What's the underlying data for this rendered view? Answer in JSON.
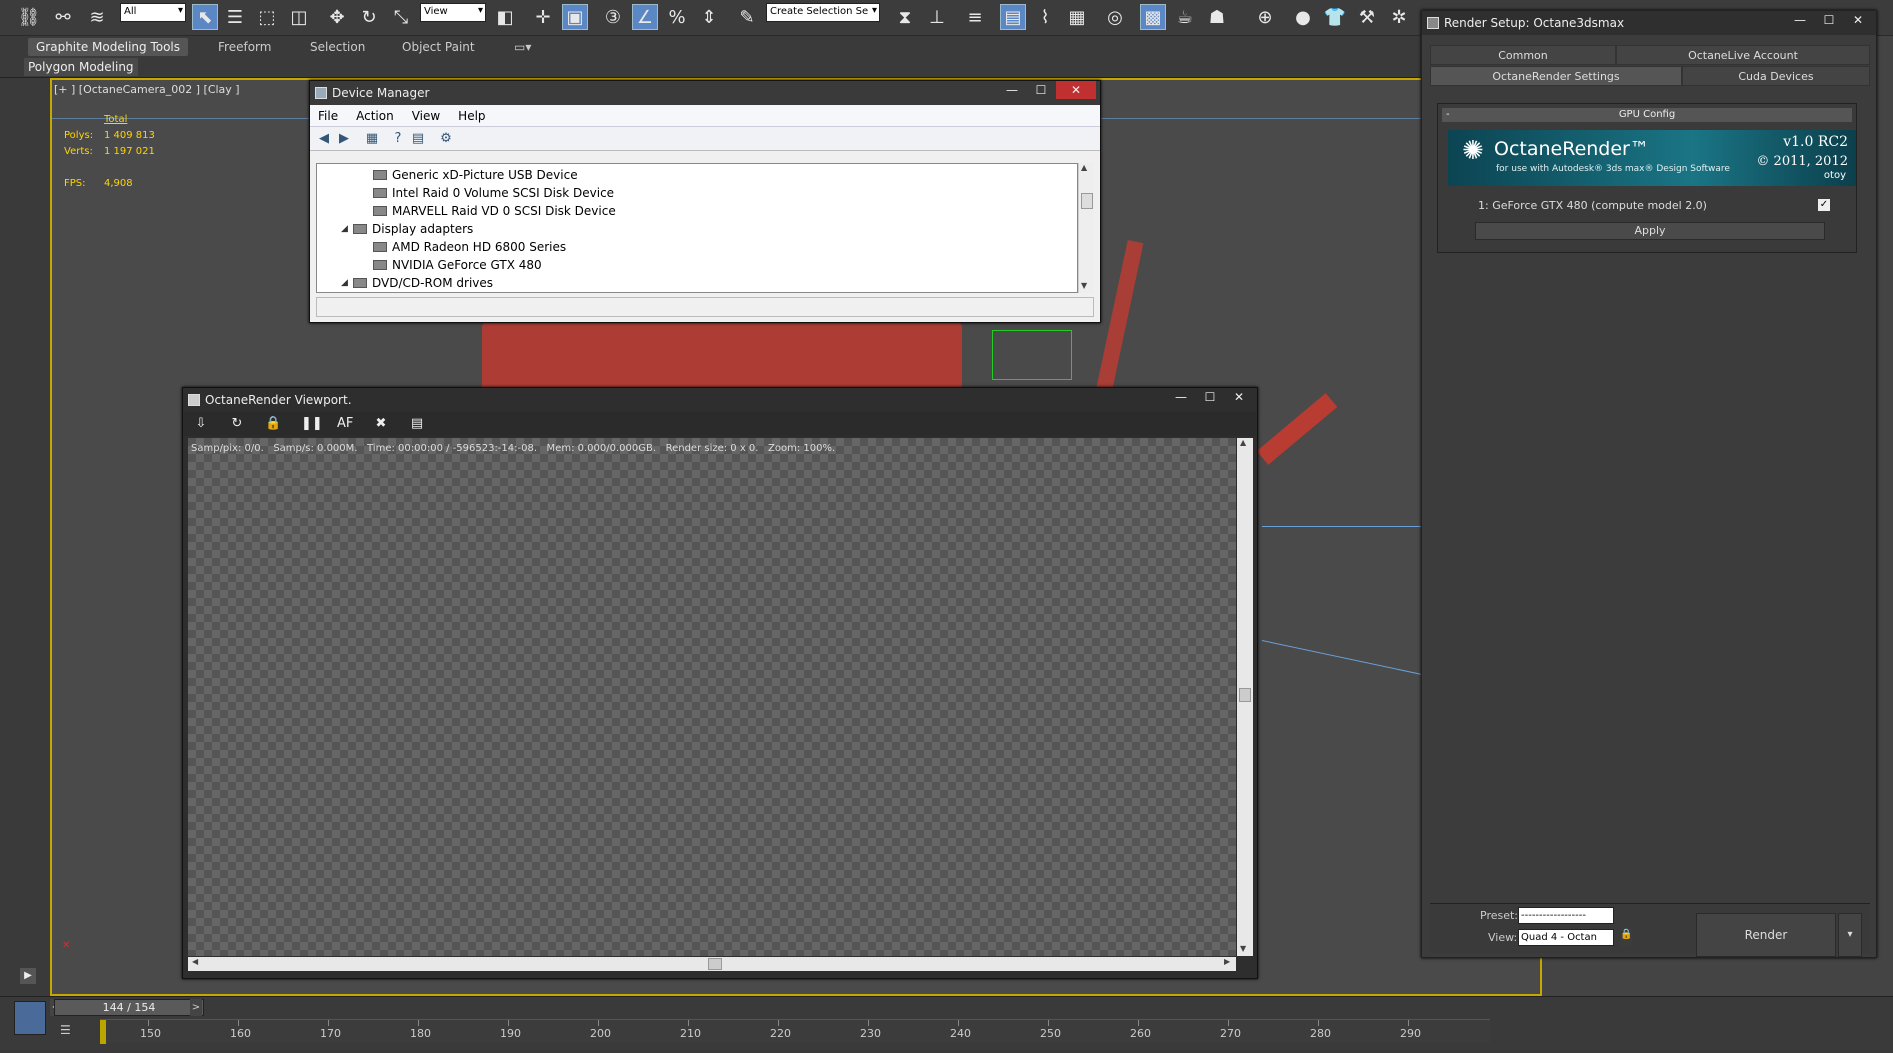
{
  "toolbar": {
    "selection_filter": "All",
    "ref_coord": "View",
    "named_selection": "Create Selection Se"
  },
  "ribbon": {
    "tabs": [
      "Graphite Modeling Tools",
      "Freeform",
      "Selection",
      "Object Paint"
    ],
    "panel": "Polygon Modeling"
  },
  "viewport": {
    "label": "[+ ] [OctaneCamera_002 ] [Clay ]",
    "stats_header": "Total",
    "polys_label": "Polys:",
    "polys_value": "1 409 813",
    "verts_label": "Verts:",
    "verts_value": "1 197 021",
    "fps_label": "FPS:",
    "fps_value": "4,908"
  },
  "timeline": {
    "frame": "144 / 154",
    "ticks": [
      "150",
      "160",
      "170",
      "180",
      "190",
      "200",
      "210",
      "220",
      "230",
      "240",
      "250",
      "260",
      "270",
      "280",
      "290"
    ]
  },
  "device_manager": {
    "title": "Device Manager",
    "menu": [
      "File",
      "Action",
      "View",
      "Help"
    ],
    "items": [
      {
        "label": "Generic xD-Picture USB Device",
        "level": 2
      },
      {
        "label": "Intel Raid 0 Volume SCSI Disk Device",
        "level": 2
      },
      {
        "label": "MARVELL Raid VD 0 SCSI Disk Device",
        "level": 2
      },
      {
        "label": "Display adapters",
        "level": 1
      },
      {
        "label": "AMD Radeon HD 6800 Series",
        "level": 2
      },
      {
        "label": "NVIDIA GeForce GTX 480",
        "level": 2
      },
      {
        "label": "DVD/CD-ROM drives",
        "level": 1
      }
    ]
  },
  "octane_viewport": {
    "title": "OctaneRender Viewport.",
    "status": "Samp/pix: 0/0.   Samp/s: 0.000M.   Time: 00:00:00 / -596523:-14:-08.   Mem: 0.000/0.000GB.   Render size: 0 x 0.   Zoom: 100%."
  },
  "render_setup": {
    "title": "Render Setup: Octane3dsmax",
    "tabs_row1": [
      "Common",
      "OctaneLive Account"
    ],
    "tabs_row2": [
      "OctaneRender Settings",
      "Cuda Devices"
    ],
    "panel_title": "GPU Config",
    "panel_collapse": "-",
    "banner_name": "OctaneRender™",
    "banner_sub": "for use with Autodesk® 3ds max® Design Software",
    "banner_version": "v1.0 RC2",
    "banner_copyright": "© 2011, 2012",
    "banner_brand": "otoy",
    "gpu_entry": "1:  GeForce GTX 480 (compute model 2.0)",
    "gpu_checked": "✓",
    "apply_label": "Apply",
    "preset_label": "Preset:",
    "preset_value": "------------------",
    "view_label": "View:",
    "view_value": "Quad 4 - Octan",
    "render_label": "Render"
  },
  "colors": {
    "viewport_border": "#c8a800",
    "stats_text": "#ffd400",
    "accent_blue": "#5b87c4",
    "scene_red": "#b83c32"
  }
}
